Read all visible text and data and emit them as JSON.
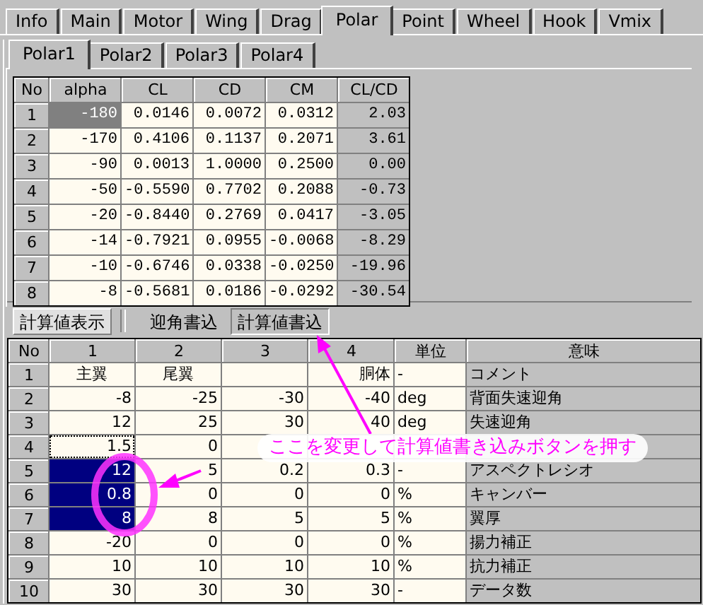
{
  "tabs": [
    {
      "label": "Info",
      "selected": false
    },
    {
      "label": "Main",
      "selected": false
    },
    {
      "label": "Motor",
      "selected": false
    },
    {
      "label": "Wing",
      "selected": false
    },
    {
      "label": "Drag",
      "selected": false
    },
    {
      "label": "Polar",
      "selected": true
    },
    {
      "label": "Point",
      "selected": false
    },
    {
      "label": "Wheel",
      "selected": false
    },
    {
      "label": "Hook",
      "selected": false
    },
    {
      "label": "Vmix",
      "selected": false
    }
  ],
  "subtabs": [
    {
      "label": "Polar1",
      "selected": true
    },
    {
      "label": "Polar2",
      "selected": false
    },
    {
      "label": "Polar3",
      "selected": false
    },
    {
      "label": "Polar4",
      "selected": false
    }
  ],
  "polar_table": {
    "columns": [
      {
        "label": "No",
        "kind": "index"
      },
      {
        "label": "alpha",
        "kind": "input"
      },
      {
        "label": "CL",
        "kind": "input"
      },
      {
        "label": "CD",
        "kind": "input"
      },
      {
        "label": "CM",
        "kind": "input"
      },
      {
        "label": "CL/CD",
        "kind": "output"
      }
    ],
    "rows": [
      {
        "cells": [
          "1",
          "-180",
          "0.0146",
          "0.0072",
          "0.0312",
          "2.03"
        ],
        "selected": true,
        "focused": false
      },
      {
        "cells": [
          "2",
          "-170",
          "0.4106",
          "0.1137",
          "0.2071",
          "3.61"
        ],
        "selected": false,
        "focused": false
      },
      {
        "cells": [
          "3",
          "-90",
          "0.0013",
          "1.0000",
          "0.2500",
          "0.00"
        ],
        "selected": false,
        "focused": false
      },
      {
        "cells": [
          "4",
          "-50",
          "-0.5590",
          "0.7702",
          "0.2088",
          "-0.73"
        ],
        "selected": false,
        "focused": false
      },
      {
        "cells": [
          "5",
          "-20",
          "-0.8440",
          "0.2769",
          "0.0417",
          "-3.05"
        ],
        "selected": false,
        "focused": false
      },
      {
        "cells": [
          "6",
          "-14",
          "-0.7921",
          "0.0955",
          "-0.0068",
          "-8.29"
        ],
        "selected": false,
        "focused": false
      },
      {
        "cells": [
          "7",
          "-10",
          "-0.6746",
          "0.0338",
          "-0.0250",
          "-19.96"
        ],
        "selected": false,
        "focused": false
      },
      {
        "cells": [
          "8",
          "-8",
          "-0.5681",
          "0.0186",
          "-0.0292",
          "-30.54"
        ],
        "selected": false,
        "focused": false
      }
    ]
  },
  "buttons": [
    {
      "label": "計算値表示",
      "pressed": true,
      "focused": false
    },
    {
      "label": "迎角書込",
      "pressed": false,
      "focused": false
    },
    {
      "label": "計算値書込",
      "pressed": false,
      "focused": true
    }
  ],
  "param_table": {
    "columns": [
      {
        "label": "No",
        "kind": "index"
      },
      {
        "label": "1",
        "kind": "input"
      },
      {
        "label": "2",
        "kind": "input"
      },
      {
        "label": "3",
        "kind": "input"
      },
      {
        "label": "4",
        "kind": "input"
      },
      {
        "label": "単位",
        "kind": "unit"
      },
      {
        "label": "意味",
        "kind": "output"
      }
    ],
    "rows": [
      {
        "cells": [
          "1",
          "主翼",
          "尾翼",
          null,
          "胴体",
          "-",
          "コメント"
        ],
        "selected": false,
        "focused": false
      },
      {
        "cells": [
          "2",
          "-8",
          "-25",
          "-30",
          "-40",
          "deg",
          "背面失速迎角"
        ],
        "selected": false,
        "focused": false
      },
      {
        "cells": [
          "3",
          "12",
          "25",
          "30",
          "40",
          "deg",
          "失速迎角"
        ],
        "selected": false,
        "focused": false
      },
      {
        "cells": [
          "4",
          "1.5",
          "0",
          null,
          null,
          null,
          null
        ],
        "selected": false,
        "focused": true
      },
      {
        "cells": [
          "5",
          "12",
          "5",
          "0.2",
          "0.3",
          "-",
          "アスペクトレシオ"
        ],
        "selected": true,
        "focused": false
      },
      {
        "cells": [
          "6",
          "0.8",
          "0",
          "0",
          "0",
          "%",
          "キャンバー"
        ],
        "selected": true,
        "focused": false
      },
      {
        "cells": [
          "7",
          "8",
          "8",
          "5",
          "5",
          "%",
          "翼厚"
        ],
        "selected": true,
        "focused": false
      },
      {
        "cells": [
          "8",
          "-20",
          "0",
          "0",
          "0",
          "%",
          "揚力補正"
        ],
        "selected": false,
        "focused": false
      },
      {
        "cells": [
          "9",
          "10",
          "10",
          "10",
          "10",
          "%",
          "抗力補正"
        ],
        "selected": false,
        "focused": false
      },
      {
        "cells": [
          "10",
          "30",
          "30",
          "30",
          "30",
          "-",
          "データ数"
        ],
        "selected": false,
        "focused": false
      }
    ]
  },
  "callout": {
    "text": "ここを変更して計算値書き込みボタンを押す"
  }
}
